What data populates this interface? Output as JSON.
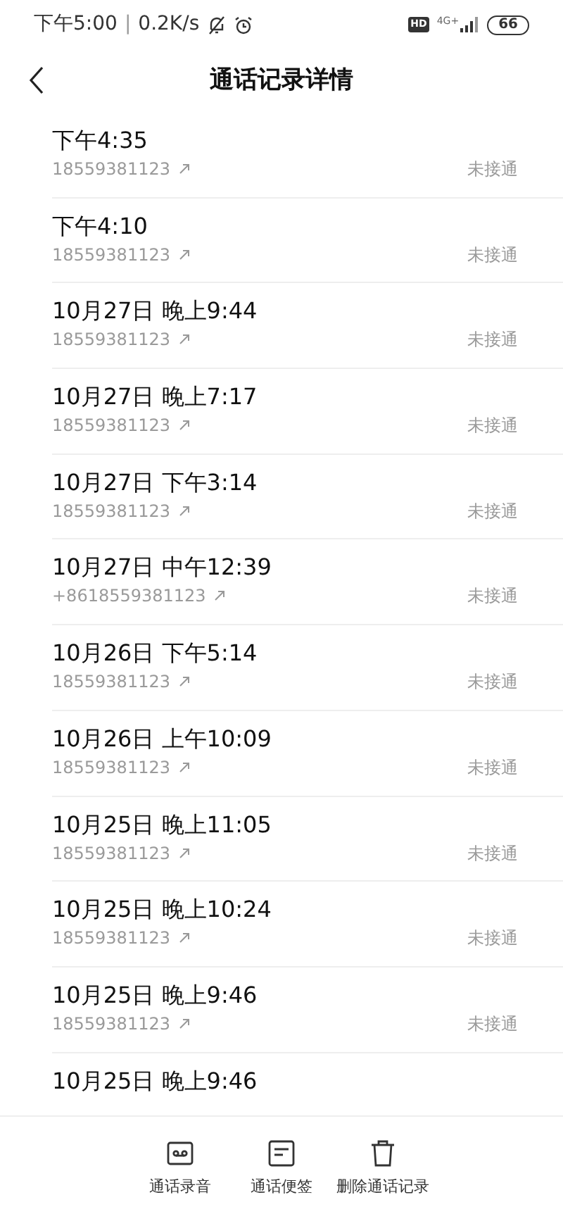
{
  "status_bar": {
    "time": "下午5:00",
    "separator": "|",
    "speed": "0.2K/s",
    "hd": "HD",
    "network": "4G+",
    "battery": "66"
  },
  "header": {
    "title": "通话记录详情"
  },
  "calls": [
    {
      "time": "下午4:35",
      "number": "18559381123",
      "status": "未接通"
    },
    {
      "time": "下午4:10",
      "number": "18559381123",
      "status": "未接通"
    },
    {
      "time": "10月27日 晚上9:44",
      "number": "18559381123",
      "status": "未接通"
    },
    {
      "time": "10月27日 晚上7:17",
      "number": "18559381123",
      "status": "未接通"
    },
    {
      "time": "10月27日 下午3:14",
      "number": "18559381123",
      "status": "未接通"
    },
    {
      "time": "10月27日 中午12:39",
      "number": "+8618559381123",
      "status": "未接通"
    },
    {
      "time": "10月26日 下午5:14",
      "number": "18559381123",
      "status": "未接通"
    },
    {
      "time": "10月26日 上午10:09",
      "number": "18559381123",
      "status": "未接通"
    },
    {
      "time": "10月25日 晚上11:05",
      "number": "18559381123",
      "status": "未接通"
    },
    {
      "time": "10月25日 晚上10:24",
      "number": "18559381123",
      "status": "未接通"
    },
    {
      "time": "10月25日 晚上9:46",
      "number": "18559381123",
      "status": "未接通"
    },
    {
      "time": "10月25日 晚上9:46"
    }
  ],
  "actions": [
    {
      "kind": "recording",
      "label": "通话录音"
    },
    {
      "kind": "note",
      "label": "通话便签"
    },
    {
      "kind": "delete",
      "label": "删除通话记录"
    }
  ]
}
